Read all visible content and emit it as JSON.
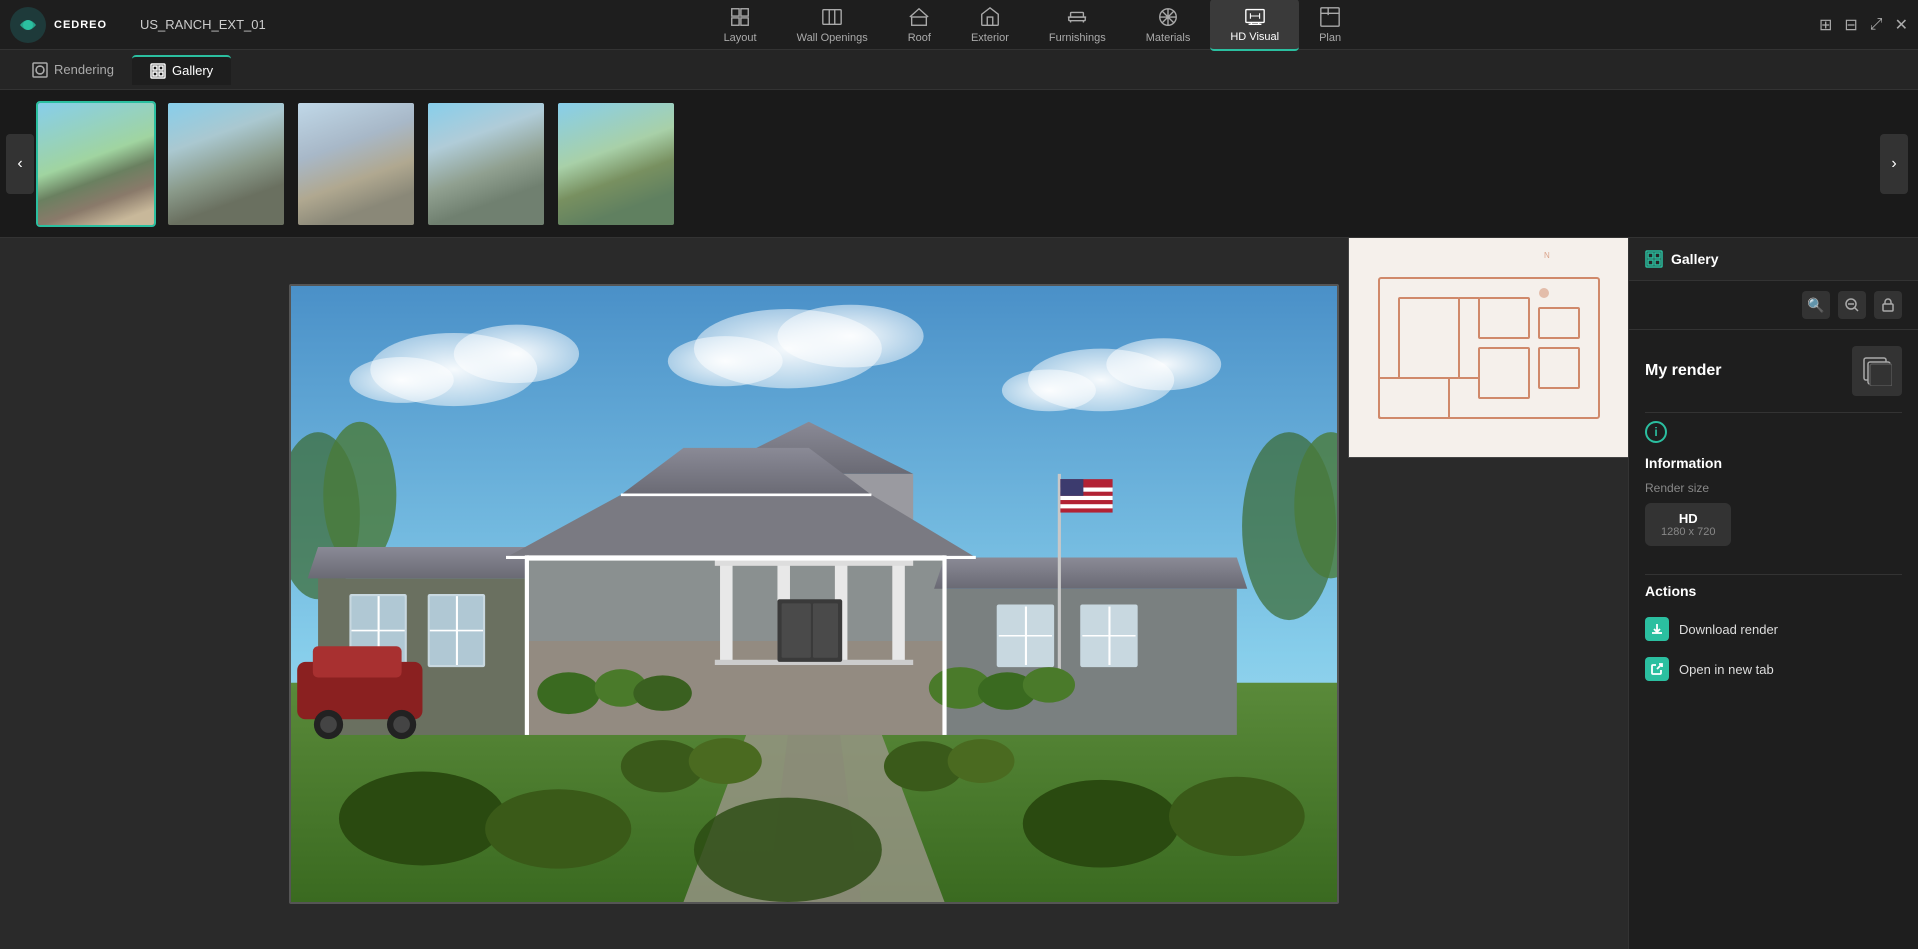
{
  "app": {
    "logo_text": "CEDREO",
    "project_name": "US_RANCH_EXT_01"
  },
  "nav_tools": [
    {
      "id": "layout",
      "label": "Layout",
      "icon": "layout-icon",
      "active": false
    },
    {
      "id": "wall_openings",
      "label": "Wall Openings",
      "icon": "wall-openings-icon",
      "active": false
    },
    {
      "id": "roof",
      "label": "Roof",
      "icon": "roof-icon",
      "active": false
    },
    {
      "id": "exterior",
      "label": "Exterior",
      "icon": "exterior-icon",
      "active": false
    },
    {
      "id": "furnishings",
      "label": "Furnishings",
      "icon": "furnishings-icon",
      "active": false
    },
    {
      "id": "materials",
      "label": "Materials",
      "icon": "materials-icon",
      "active": false
    },
    {
      "id": "hd_visual",
      "label": "HD Visual",
      "icon": "hd-visual-icon",
      "active": true
    },
    {
      "id": "plan",
      "label": "Plan",
      "icon": "plan-icon",
      "active": false
    }
  ],
  "tabs": [
    {
      "id": "rendering",
      "label": "Rendering",
      "active": false
    },
    {
      "id": "gallery",
      "label": "Gallery",
      "active": true
    }
  ],
  "thumbnails": [
    {
      "id": 1,
      "active": true,
      "css_class": "thumb-house-1"
    },
    {
      "id": 2,
      "active": false,
      "css_class": "thumb-house-2"
    },
    {
      "id": 3,
      "active": false,
      "css_class": "thumb-house-3"
    },
    {
      "id": 4,
      "active": false,
      "css_class": "thumb-house-4"
    },
    {
      "id": 5,
      "active": false,
      "css_class": "thumb-house-5"
    }
  ],
  "panel": {
    "title": "Gallery",
    "my_render_label": "My render",
    "information_title": "Information",
    "render_size_label": "Render size",
    "hd_label": "HD",
    "hd_size": "1280 x 720",
    "actions_title": "Actions",
    "actions": [
      {
        "id": "download_render",
        "label": "Download render",
        "icon": "download-icon"
      },
      {
        "id": "open_new_tab",
        "label": "Open in new tab",
        "icon": "open-tab-icon"
      }
    ]
  },
  "zoom_controls": {
    "zoom_in": "+",
    "zoom_out": "-",
    "lock": "🔒"
  }
}
